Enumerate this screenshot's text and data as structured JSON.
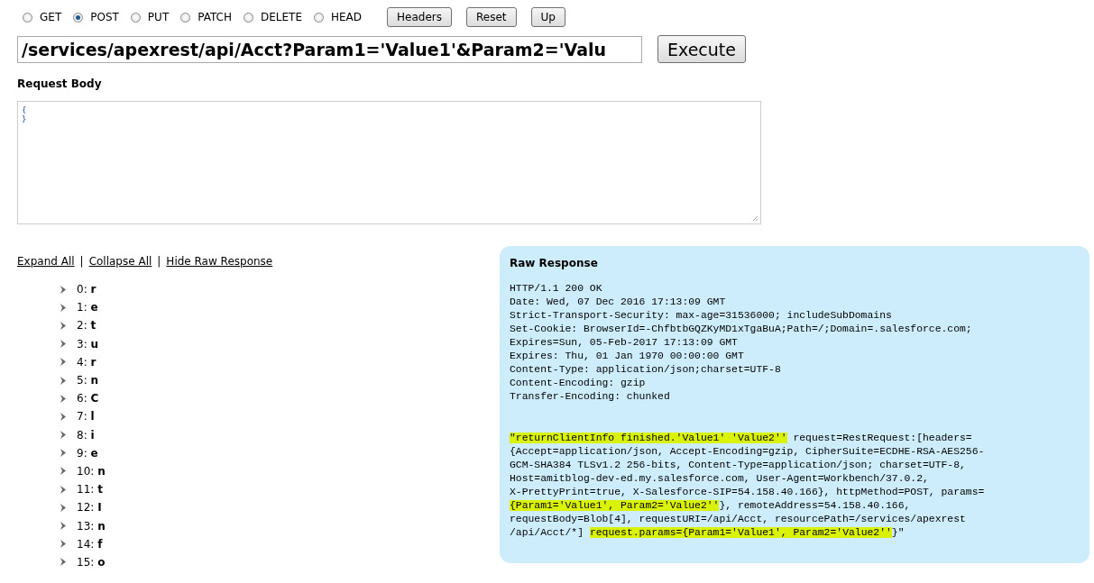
{
  "methods": [
    {
      "label": "GET",
      "selected": false
    },
    {
      "label": "POST",
      "selected": true
    },
    {
      "label": "PUT",
      "selected": false
    },
    {
      "label": "PATCH",
      "selected": false
    },
    {
      "label": "DELETE",
      "selected": false
    },
    {
      "label": "HEAD",
      "selected": false
    }
  ],
  "toolbar_buttons": [
    "Headers",
    "Reset",
    "Up"
  ],
  "url": {
    "value": "/services/apexrest/api/Acct?Param1='Value1'&Param2='Valu"
  },
  "execute_button": "Execute",
  "request_body": {
    "label": "Request Body",
    "value": "{\n}"
  },
  "links": [
    "Expand All",
    "Collapse All",
    "Hide Raw Response"
  ],
  "separator": "|",
  "tree": [
    {
      "index": "0:",
      "value": "r",
      "expanded": false
    },
    {
      "index": "1:",
      "value": "e",
      "expanded": false
    },
    {
      "index": "2:",
      "value": "t",
      "expanded": false
    },
    {
      "index": "3:",
      "value": "u",
      "expanded": false
    },
    {
      "index": "4:",
      "value": "r",
      "expanded": false
    },
    {
      "index": "5:",
      "value": "n",
      "expanded": false
    },
    {
      "index": "6:",
      "value": "C",
      "expanded": false
    },
    {
      "index": "7:",
      "value": "l",
      "expanded": false
    },
    {
      "index": "8:",
      "value": "i",
      "expanded": false
    },
    {
      "index": "9:",
      "value": "e",
      "expanded": false
    },
    {
      "index": "10:",
      "value": "n",
      "expanded": false
    },
    {
      "index": "11:",
      "value": "t",
      "expanded": false
    },
    {
      "index": "12:",
      "value": "I",
      "expanded": false
    },
    {
      "index": "13:",
      "value": "n",
      "expanded": false
    },
    {
      "index": "14:",
      "value": "f",
      "expanded": false
    },
    {
      "index": "15:",
      "value": "o",
      "expanded": false
    }
  ],
  "raw_response": {
    "title": "Raw Response",
    "headers": [
      "HTTP/1.1 200 OK",
      "Date: Wed, 07 Dec 2016 17:13:09 GMT",
      "Strict-Transport-Security: max-age=31536000; includeSubDomains",
      "Set-Cookie: BrowserId=-ChfbtbGQZKyMD1xTgaBuA;Path=/;Domain=.salesforce.com;",
      "Expires=Sun, 05-Feb-2017 17:13:09 GMT",
      "Expires: Thu, 01 Jan 1970 00:00:00 GMT",
      "Content-Type: application/json;charset=UTF-8",
      "Content-Encoding: gzip",
      "Transfer-Encoding: chunked"
    ],
    "body": [
      {
        "text": "\"returnClientInfo finished.'Value1' 'Value2''",
        "highlighted": true
      },
      {
        "text": " request=RestRequest:[headers=\n{Accept=application/json, Accept-Encoding=gzip, CipherSuite=ECDHE-RSA-AES256-\nGCM-SHA384 TLSv1.2 256-bits, Content-Type=application/json; charset=UTF-8,\nHost=amitblog-dev-ed.my.salesforce.com, User-Agent=Workbench/37.0.2,\nX-PrettyPrint=true, X-Salesforce-SIP=54.158.40.166}, httpMethod=POST, params=\n",
        "highlighted": false
      },
      {
        "text": "{Param1='Value1', Param2='Value2''",
        "highlighted": true
      },
      {
        "text": "}, remoteAddress=54.158.40.166,\nrequestBody=Blob[4], requestURI=/api/Acct, resourcePath=/services/apexrest\n/api/Acct/*] ",
        "highlighted": false
      },
      {
        "text": "request.params={Param1='Value1', Param2='Value2''",
        "highlighted": true
      },
      {
        "text": "}\"",
        "highlighted": false
      }
    ]
  }
}
